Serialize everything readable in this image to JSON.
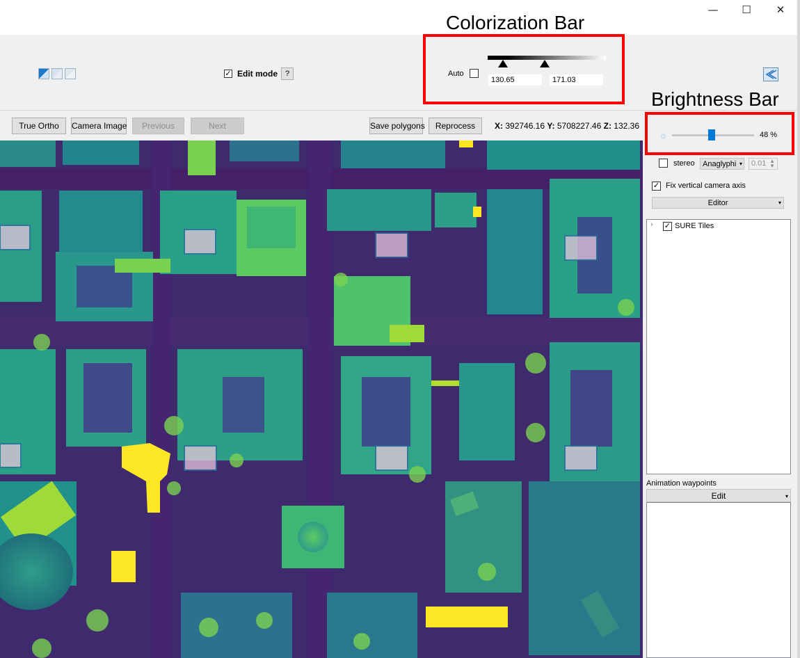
{
  "window": {
    "minimize_glyph": "—",
    "maximize_glyph": "☐",
    "close_glyph": "✕"
  },
  "toolbar": {
    "edit_mode_label": "Edit mode",
    "edit_mode_checked": true,
    "help_label": "?",
    "auto_label": "Auto",
    "auto_checked": false,
    "color_min": "130.65",
    "color_max": "171.03"
  },
  "annotations": {
    "colorization": "Colorization Bar",
    "brightness": "Brightness Bar"
  },
  "buttons": {
    "true_ortho": "True Ortho",
    "camera_image": "Camera Image",
    "previous": "Previous",
    "next": "Next",
    "save_polygons": "Save polygons",
    "reprocess": "Reprocess"
  },
  "coordinates": {
    "x_label": "X:",
    "x_value": "392746.16",
    "y_label": "Y:",
    "y_value": "5708227.46",
    "z_label": "Z:",
    "z_value": "132.36"
  },
  "brightness": {
    "value_text": "48 %",
    "value_fraction": 0.48
  },
  "stereo": {
    "label": "stereo",
    "checked": false,
    "mode": "Anaglyphi",
    "offset": "0.01"
  },
  "camera": {
    "fix_vertical_label": "Fix vertical camera axis",
    "fix_vertical_checked": true,
    "editor_dropdown": "Editor"
  },
  "layers": {
    "items": [
      {
        "label": "SURE Tiles",
        "checked": true
      }
    ]
  },
  "animation": {
    "header": "Animation waypoints",
    "edit_dropdown": "Edit"
  },
  "colors": {
    "map_background": "#3f2a6e",
    "colormap": "viridis",
    "annotation_box": "#ff0000",
    "slider_handle": "#0078d7"
  }
}
